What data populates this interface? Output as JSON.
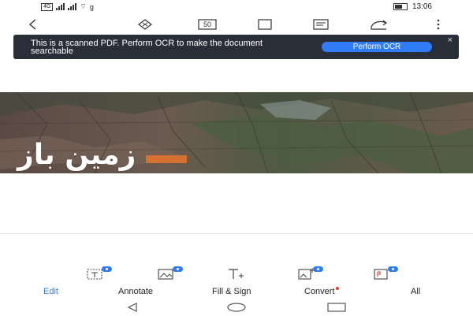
{
  "status_bar": {
    "network_badge": "4G",
    "network_label": "g",
    "time": "13:06"
  },
  "toolbar": {
    "icons": [
      "back-icon",
      "outline-icon",
      "page-view-icon",
      "crop-icon",
      "reader-mode-icon",
      "share-icon",
      "more-icon"
    ],
    "page_view_label": "50"
  },
  "ocr_banner": {
    "message": "This is a scanned PDF. Perform OCR to make the document searchable",
    "button_label": "Perform OCR",
    "close_label": "×"
  },
  "document": {
    "caption": "زمین باز",
    "highlight_color": "#e8742a"
  },
  "tools": {
    "icons": [
      "edit-text-icon",
      "edit-image-icon",
      "add-text-icon",
      "add-image-icon",
      "pdf-convert-icon"
    ]
  },
  "tabs": [
    {
      "label": "Edit",
      "active": true
    },
    {
      "label": "Annotate",
      "active": false
    },
    {
      "label": "Fill & Sign",
      "active": false
    },
    {
      "label": "Convert",
      "active": false
    },
    {
      "label": "All",
      "active": false
    }
  ],
  "colors": {
    "accent": "#2f7cf6",
    "banner_bg": "#2a2e38",
    "notification": "#e53935"
  },
  "navigation": [
    "nav-back-icon",
    "nav-home-icon",
    "nav-recents-icon"
  ]
}
